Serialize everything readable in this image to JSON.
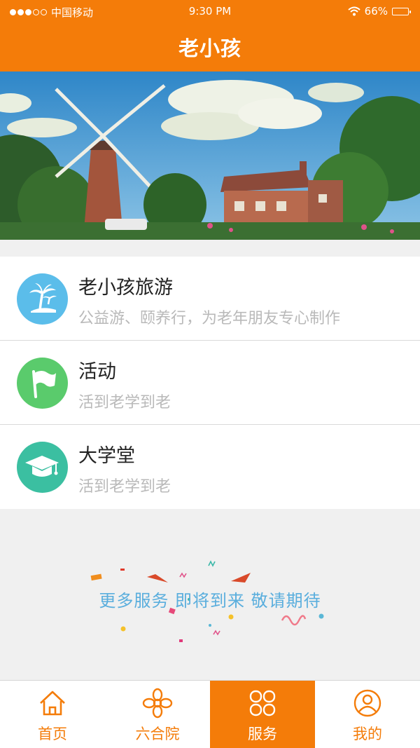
{
  "status_bar": {
    "carrier": "中国移动",
    "time": "9:30 PM",
    "battery": "66%",
    "battery_level": 0.66
  },
  "header": {
    "title": "老小孩"
  },
  "services": [
    {
      "name": "老小孩旅游",
      "desc": "公益游、颐养行，为老年朋友专心制作",
      "icon": "palm-tree-icon",
      "color": "#5bbdea"
    },
    {
      "name": "活动",
      "desc": "活到老学到老",
      "icon": "flag-icon",
      "color": "#5acb6c"
    },
    {
      "name": "大学堂",
      "desc": "活到老学到老",
      "icon": "graduation-cap-icon",
      "color": "#3bbfa1"
    }
  ],
  "more_services": {
    "text": "更多服务 即将到来 敬请期待"
  },
  "tabbar": {
    "tabs": [
      {
        "label": "首页",
        "icon": "home-icon"
      },
      {
        "label": "六合院",
        "icon": "flower-icon"
      },
      {
        "label": "服务",
        "icon": "services-grid-icon",
        "active": true
      },
      {
        "label": "我的",
        "icon": "user-icon"
      }
    ]
  },
  "colors": {
    "accent": "#f47c09",
    "more_text": "#5aaedd"
  }
}
